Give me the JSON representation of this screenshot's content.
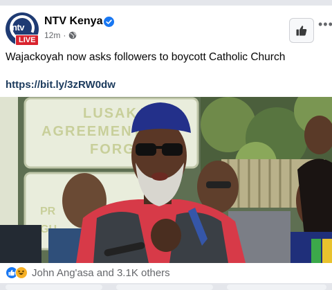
{
  "post": {
    "page_name": "NTV Kenya",
    "time": "12m",
    "live_label": "LIVE",
    "text": "Wajackoyah now asks followers to boycott Catholic Church",
    "link": "https://bit.ly/3zRW0dw"
  },
  "photo": {
    "sign_lines": [
      "LUSAKA",
      "AGREEMENT",
      "FORG"
    ],
    "sign2_lines": [
      "PR",
      "GU"
    ]
  },
  "reactions": {
    "summary": "John Ang'asa and 3.1K others",
    "icons": [
      "like-icon",
      "haha-icon"
    ]
  },
  "colors": {
    "link": "#1b3a5c",
    "verified": "#1877f2",
    "live": "#d9232e",
    "secondary_text": "#65676b"
  }
}
